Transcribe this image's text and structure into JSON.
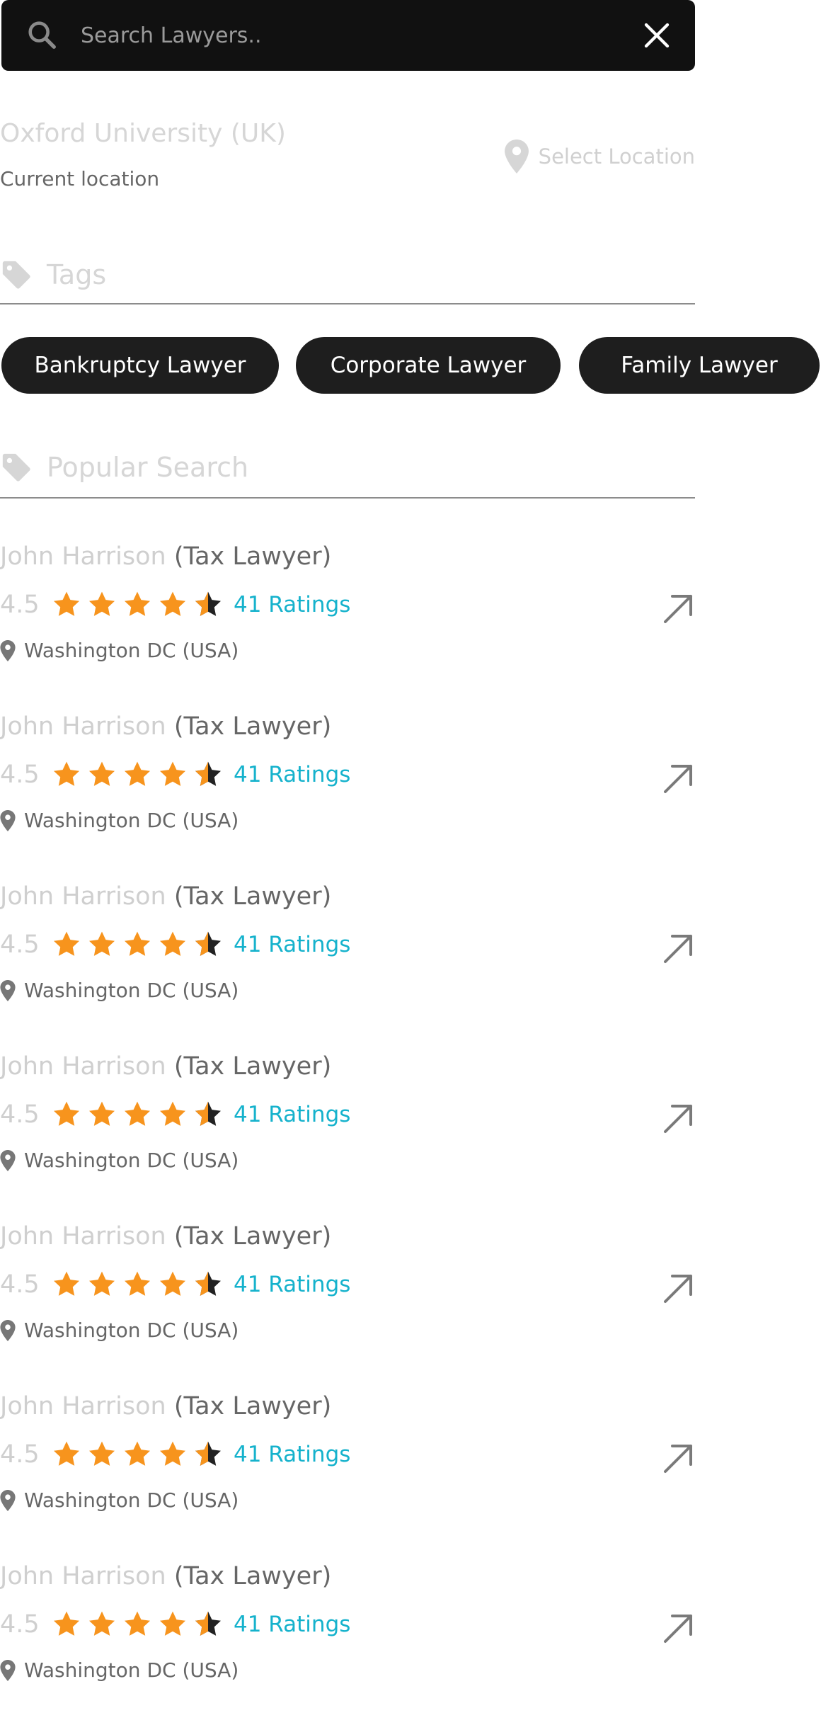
{
  "search": {
    "placeholder": "Search Lawyers..",
    "value": ""
  },
  "location": {
    "title": "Oxford University (UK)",
    "subtitle": "Current location",
    "select_label": "Select Location"
  },
  "tags_section": {
    "title": "Tags",
    "chips": [
      "Bankruptcy Lawyer",
      "Corporate Lawyer",
      "Family Lawyer"
    ]
  },
  "popular_section": {
    "title": "Popular Search"
  },
  "lawyers": [
    {
      "name": "John Harrison",
      "type": "(Tax Lawyer)",
      "rating": "4.5",
      "ratings_count": "41 Ratings",
      "location": "Washington DC (USA)"
    },
    {
      "name": "John Harrison",
      "type": "(Tax Lawyer)",
      "rating": "4.5",
      "ratings_count": "41 Ratings",
      "location": "Washington DC (USA)"
    },
    {
      "name": "John Harrison",
      "type": "(Tax Lawyer)",
      "rating": "4.5",
      "ratings_count": "41 Ratings",
      "location": "Washington DC (USA)"
    },
    {
      "name": "John Harrison",
      "type": "(Tax Lawyer)",
      "rating": "4.5",
      "ratings_count": "41 Ratings",
      "location": "Washington DC (USA)"
    },
    {
      "name": "John Harrison",
      "type": "(Tax Lawyer)",
      "rating": "4.5",
      "ratings_count": "41 Ratings",
      "location": "Washington DC (USA)"
    },
    {
      "name": "John Harrison",
      "type": "(Tax Lawyer)",
      "rating": "4.5",
      "ratings_count": "41 Ratings",
      "location": "Washington DC (USA)"
    },
    {
      "name": "John Harrison",
      "type": "(Tax Lawyer)",
      "rating": "4.5",
      "ratings_count": "41 Ratings",
      "location": "Washington DC (USA)"
    }
  ],
  "colors": {
    "search_bg": "#111111",
    "chip_bg": "#1e1e1e",
    "star_fill": "#f7941d",
    "star_empty": "#222222",
    "ratings_link": "#15b2cc",
    "muted_text": "#cfcfcf"
  },
  "icons": {
    "search": "search-icon",
    "clear": "close-icon",
    "location": "map-pin-icon",
    "tag": "tag-icon",
    "open": "arrow-up-right-icon",
    "star": "star-icon"
  }
}
